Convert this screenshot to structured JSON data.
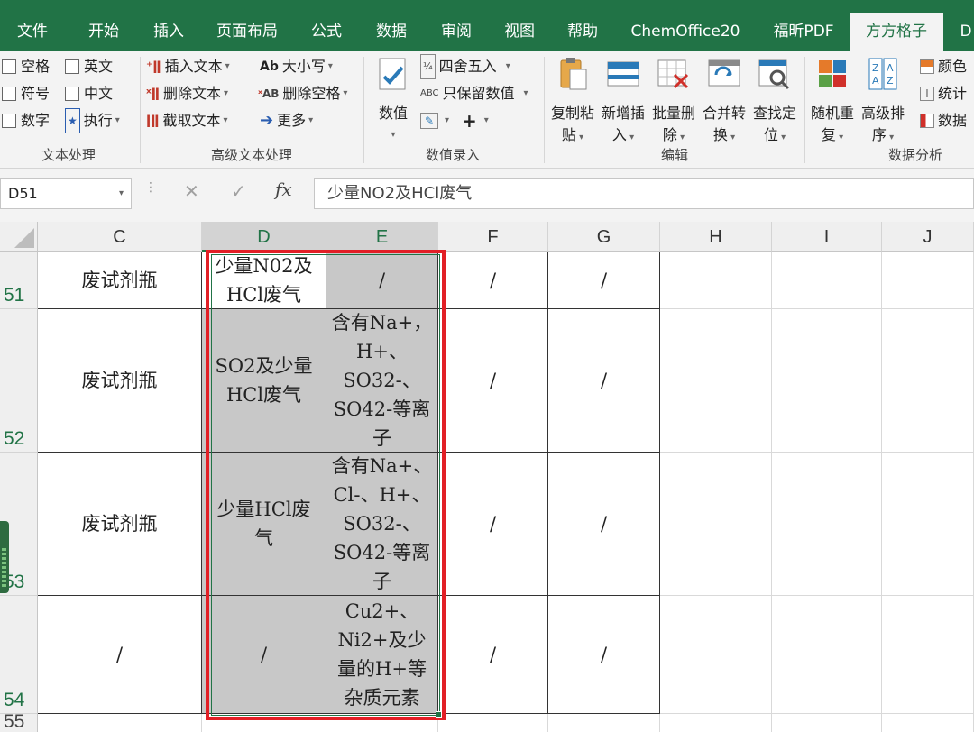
{
  "menu": {
    "tabs": [
      "文件",
      "开始",
      "插入",
      "页面布局",
      "公式",
      "数据",
      "审阅",
      "视图",
      "帮助",
      "ChemOffice20",
      "福昕PDF",
      "方方格子",
      "D"
    ],
    "active": "方方格子"
  },
  "ribbon": {
    "text_group": {
      "label": "文本处理",
      "checks": [
        "空格",
        "英文",
        "符号",
        "中文",
        "数字"
      ],
      "execute": "执行"
    },
    "adv_text": {
      "label": "高级文本处理",
      "items": [
        "插入文本",
        "大小写",
        "删除文本",
        "删除空格",
        "截取文本",
        "更多"
      ]
    },
    "numeric": {
      "label": "数值录入",
      "big": "数值",
      "items": [
        "四舍五入",
        "只保留数值"
      ],
      "plus": "+"
    },
    "edit": {
      "label": "编辑",
      "buttons": [
        {
          "l1": "复制粘",
          "l2": "贴"
        },
        {
          "l1": "新增插",
          "l2": "入"
        },
        {
          "l1": "批量删",
          "l2": "除"
        },
        {
          "l1": "合并转",
          "l2": "换"
        },
        {
          "l1": "查找定",
          "l2": "位"
        }
      ]
    },
    "analysis": {
      "label": "数据分析",
      "buttons": [
        {
          "l1": "随机重",
          "l2": "复"
        },
        {
          "l1": "高级排",
          "l2": "序"
        }
      ],
      "small": [
        "颜色",
        "统计",
        "数据"
      ]
    }
  },
  "formula_bar": {
    "name_box": "D51",
    "cancel": "✕",
    "enter": "✓",
    "fx": "fx",
    "value": "少量NO2及HCl废气"
  },
  "grid": {
    "columns": [
      "C",
      "D",
      "E",
      "F",
      "G",
      "H",
      "I",
      "J"
    ],
    "rows": [
      {
        "num": "51",
        "c": "废试剂瓶",
        "d": "少量N02及HCl废气",
        "e": "/",
        "f": "/",
        "g": "/"
      },
      {
        "num": "52",
        "c": "废试剂瓶",
        "d": "SO2及少量HCl废气",
        "e": "含有Na+，H+、SO32-、SO42-等离子",
        "f": "/",
        "g": "/"
      },
      {
        "num": "53",
        "c": "废试剂瓶",
        "d": "少量HCl废气",
        "e": "含有Na+、Cl-、H+、SO32-、SO42-等离子",
        "f": "/",
        "g": "/"
      },
      {
        "num": "54",
        "c": "/",
        "d": "/",
        "e": "Cu2+、Ni2+及少量的H+等杂质元素",
        "f": "/",
        "g": "/"
      }
    ],
    "next_row": "55"
  }
}
